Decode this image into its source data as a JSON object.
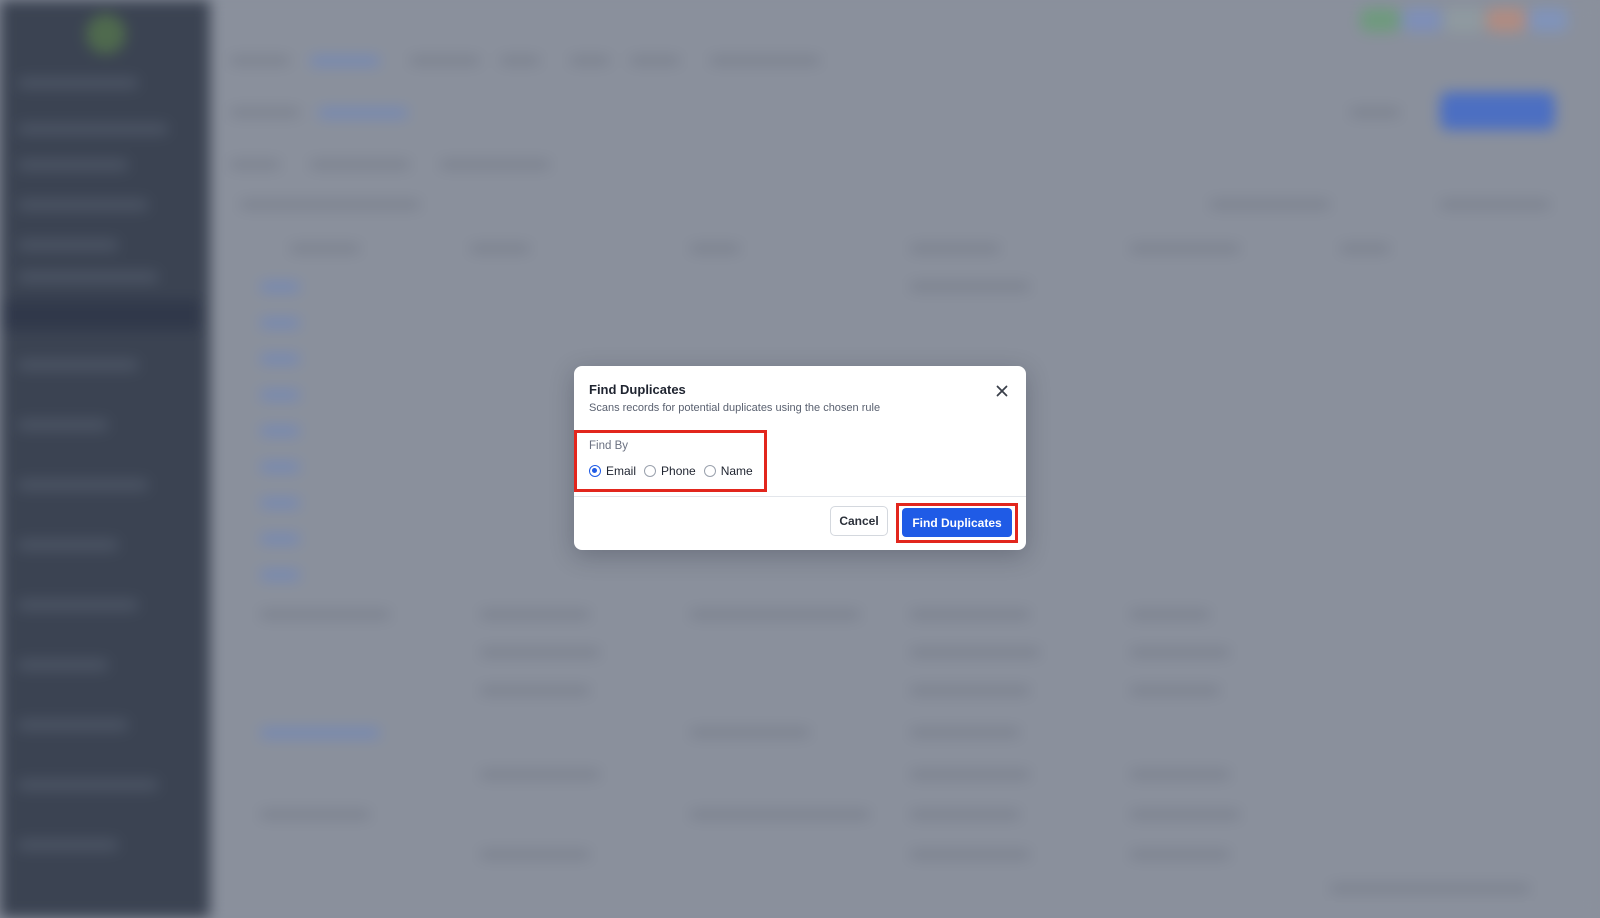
{
  "modal": {
    "title": "Find Duplicates",
    "subtitle": "Scans records for potential duplicates using the chosen rule",
    "find_by_label": "Find By",
    "options": [
      {
        "label": "Email",
        "checked": true
      },
      {
        "label": "Phone",
        "checked": false
      },
      {
        "label": "Name",
        "checked": false
      }
    ],
    "cancel_label": "Cancel",
    "primary_label": "Find Duplicates",
    "close_icon": "close-icon"
  },
  "colors": {
    "primary": "#1f5be6",
    "highlight": "#e2261d",
    "overlay": "#8a909d",
    "sidebar": "#3b4352"
  }
}
